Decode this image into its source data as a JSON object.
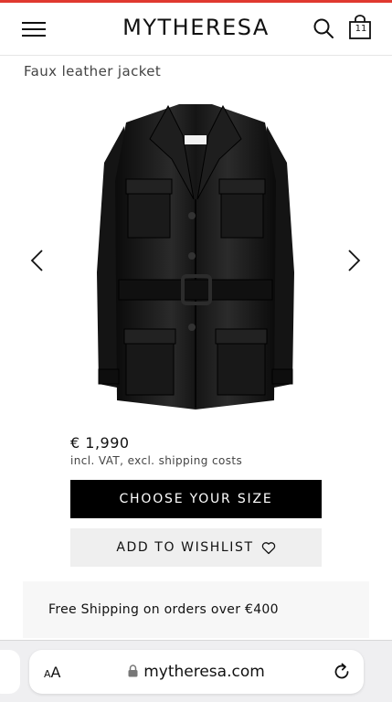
{
  "header": {
    "logo": "MYTHERESA",
    "bag_count": "11"
  },
  "product": {
    "title": "Faux leather jacket",
    "price": "€ 1,990",
    "vat_note": "incl. VAT, excl. shipping costs"
  },
  "actions": {
    "choose_size": "CHOOSE YOUR SIZE",
    "wishlist": "ADD TO WISHLIST"
  },
  "shipping": {
    "text": "Free Shipping on orders over €400"
  },
  "browser": {
    "aa_small": "A",
    "aa_large": "A",
    "url": "mytheresa.com"
  },
  "colors": {
    "accent": "#e0392f",
    "primary_button": "#000000",
    "secondary_button": "#efefef",
    "shipping_banner": "#f7f7f7"
  },
  "icons": [
    "menu-icon",
    "search-icon",
    "shopping-bag-icon",
    "chevron-left-icon",
    "chevron-right-icon",
    "heart-icon",
    "lock-icon",
    "reload-icon"
  ]
}
